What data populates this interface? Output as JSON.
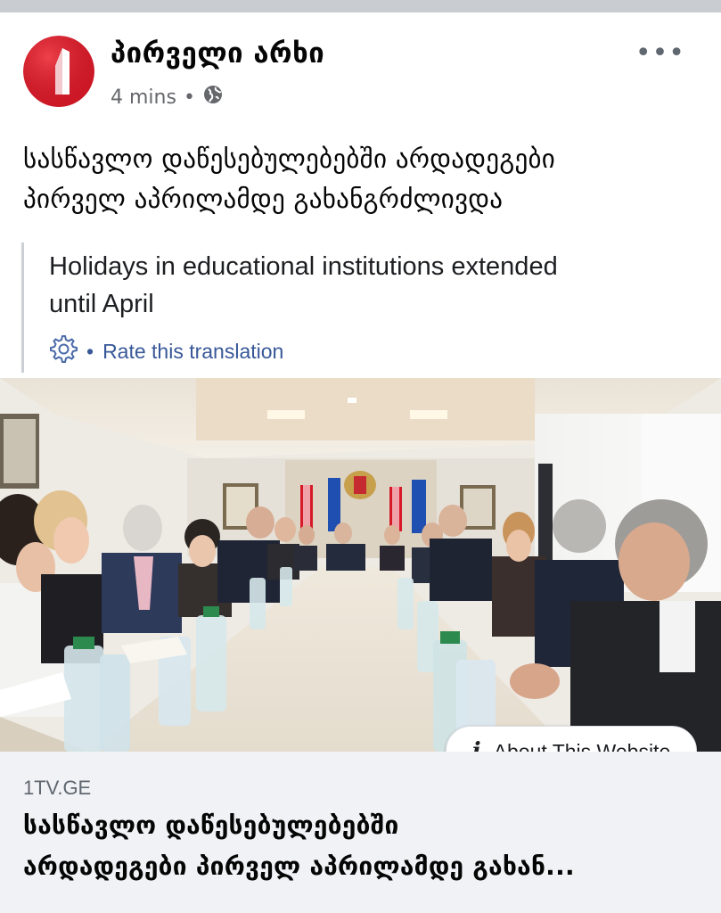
{
  "post": {
    "page_name": "პირველი არხი",
    "time": "4 mins",
    "separator": "•",
    "privacy_icon": "globe-icon",
    "more_icon": "more-icon",
    "more_label": "•••",
    "text_line1": "სასწავლო დაწესებულებებში არდადეგები",
    "text_line2": "პირველ აპრილამდე გახანგრძლივდა"
  },
  "translation": {
    "line1": "Holidays in educational institutions extended",
    "line2": "until April",
    "settings_icon": "gear-icon",
    "separator": "•",
    "rate_label": "Rate this translation"
  },
  "link": {
    "about_icon": "info-icon",
    "about_glyph": "i",
    "about_label": "About This Website",
    "domain": "1TV.GE",
    "title_line1": "სასწავლო დაწესებულებებში",
    "title_line2": "არდადეგები პირველ აპრილამდე გახან..."
  },
  "colors": {
    "accent_red": "#d71a28",
    "link_blue": "#385898",
    "flag_eu_blue": "#1f4fb0"
  }
}
